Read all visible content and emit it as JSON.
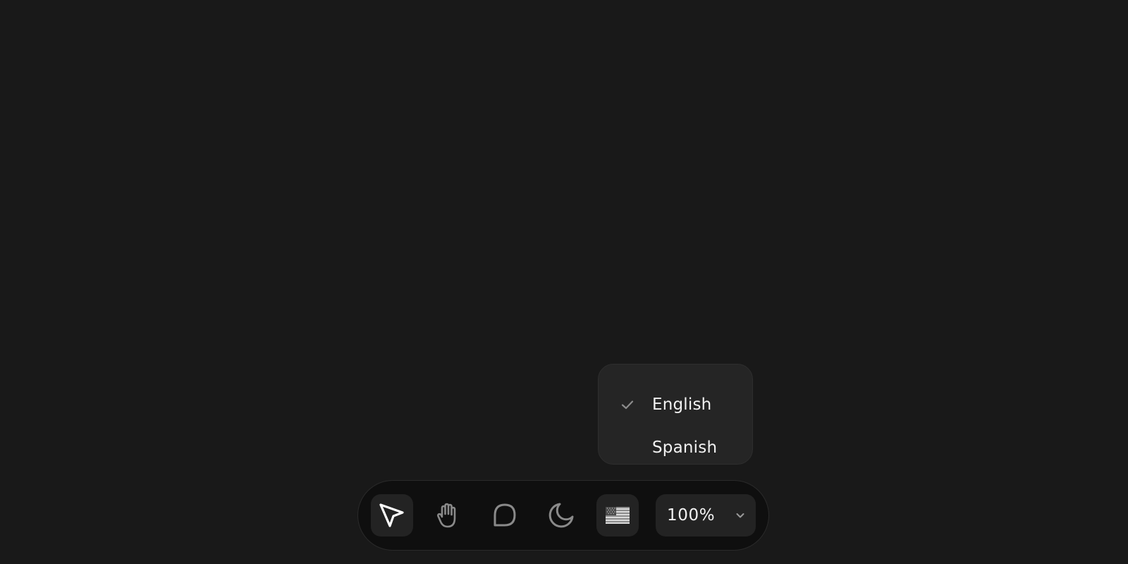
{
  "language_menu": {
    "options": [
      {
        "label": "English",
        "selected": true
      },
      {
        "label": "Spanish",
        "selected": false
      }
    ]
  },
  "toolbar": {
    "tools": [
      {
        "name": "pointer",
        "icon": "cursor-arrow-icon",
        "active": true
      },
      {
        "name": "hand",
        "icon": "hand-icon",
        "active": false
      },
      {
        "name": "comment",
        "icon": "speech-bubble-icon",
        "active": false
      },
      {
        "name": "theme",
        "icon": "moon-icon",
        "active": false
      },
      {
        "name": "language",
        "icon": "us-flag-icon",
        "active": false
      }
    ],
    "zoom": {
      "value": "100%"
    }
  },
  "colors": {
    "background": "#191919",
    "toolbar_bg": "#0f0f0f",
    "button_bg": "#232323",
    "menu_bg": "#252525",
    "icon_active": "#ffffff",
    "icon_inactive": "#8a8a8a",
    "text": "#f2f2f2"
  }
}
